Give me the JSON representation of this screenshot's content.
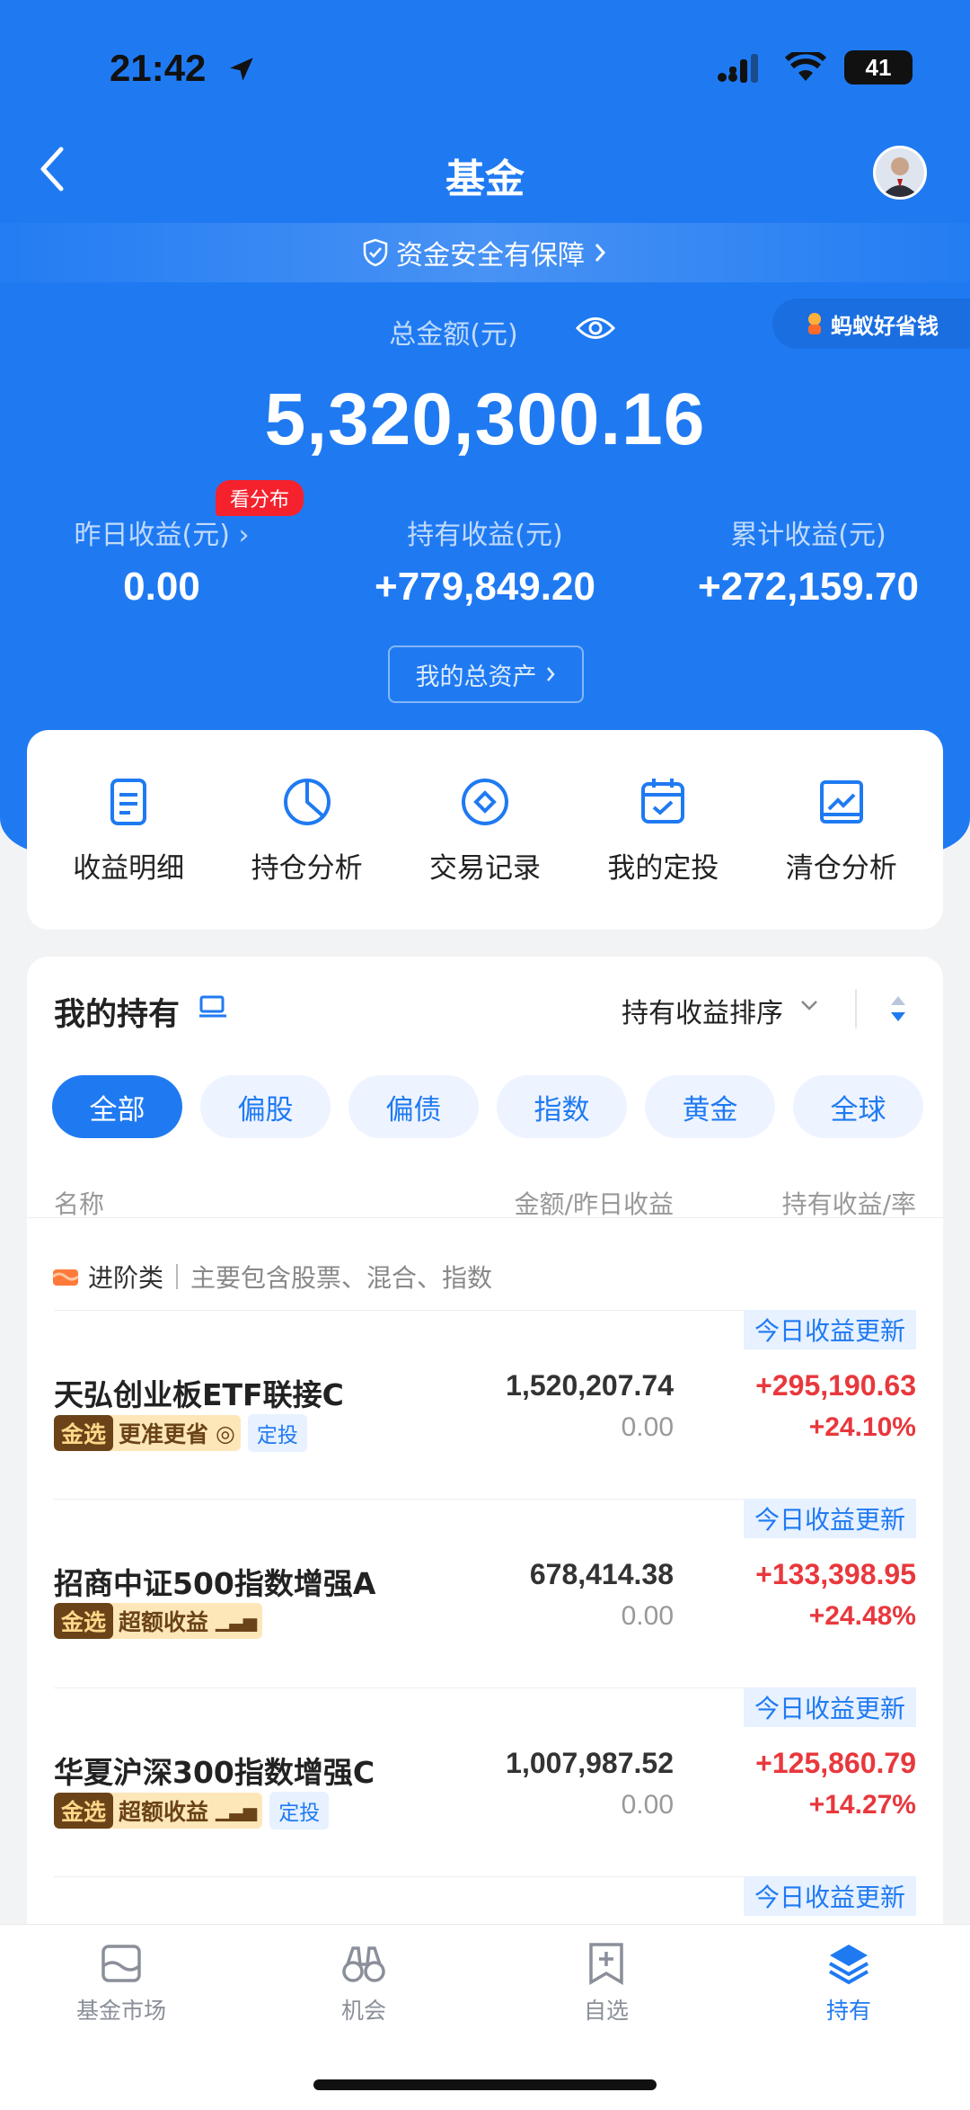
{
  "status_bar": {
    "time": "21:42",
    "battery": "41"
  },
  "header": {
    "title": "基金"
  },
  "safety_banner": {
    "text": "资金安全有保障"
  },
  "summary": {
    "total_label": "总金额(元)",
    "total_value": "5,320,300.16",
    "promo_label": "蚂蚁好省钱",
    "badge_label": "看分布",
    "stats": [
      {
        "label": "昨日收益(元)",
        "value": "0.00"
      },
      {
        "label": "持有收益(元)",
        "value": "+779,849.20"
      },
      {
        "label": "累计收益(元)",
        "value": "+272,159.70"
      }
    ],
    "assets_button": "我的总资产"
  },
  "quick_menu": [
    {
      "label": "收益明细",
      "icon": "document-icon"
    },
    {
      "label": "持仓分析",
      "icon": "pie-chart-icon"
    },
    {
      "label": "交易记录",
      "icon": "record-icon"
    },
    {
      "label": "我的定投",
      "icon": "calendar-check-icon"
    },
    {
      "label": "清仓分析",
      "icon": "trend-chart-icon"
    }
  ],
  "holdings": {
    "title": "我的持有",
    "sort_label": "持有收益排序",
    "filters": [
      "全部",
      "偏股",
      "偏债",
      "指数",
      "黄金",
      "全球"
    ],
    "active_filter": "全部",
    "columns": {
      "name": "名称",
      "amount": "金额/昨日收益",
      "profit": "持有收益/率"
    },
    "category": {
      "name": "进阶类",
      "desc": "主要包含股票、混合、指数"
    },
    "update_label": "今日收益更新",
    "jinxuan_label": "金选",
    "dingtou_label": "定投",
    "funds": [
      {
        "name": "天弘创业板ETF联接C",
        "amount": "1,520,207.74",
        "yesterday": "0.00",
        "profit": "+295,190.63",
        "rate": "+24.10%",
        "tag": "更准更省",
        "dingtou": true
      },
      {
        "name": "招商中证500指数增强A",
        "amount": "678,414.38",
        "yesterday": "0.00",
        "profit": "+133,398.95",
        "rate": "+24.48%",
        "tag": "超额收益",
        "dingtou": false
      },
      {
        "name": "华夏沪深300指数增强C",
        "amount": "1,007,987.52",
        "yesterday": "0.00",
        "profit": "+125,860.79",
        "rate": "+14.27%",
        "tag": "超额收益",
        "dingtou": true
      }
    ]
  },
  "tab_bar": [
    {
      "label": "基金市场",
      "icon": "market-icon"
    },
    {
      "label": "机会",
      "icon": "binoculars-icon"
    },
    {
      "label": "自选",
      "icon": "add-favorite-icon"
    },
    {
      "label": "持有",
      "icon": "layers-icon"
    }
  ],
  "colors": {
    "primary": "#1f7af2",
    "profit_red": "#e8383d",
    "gold_tag": "#fde7b8"
  }
}
